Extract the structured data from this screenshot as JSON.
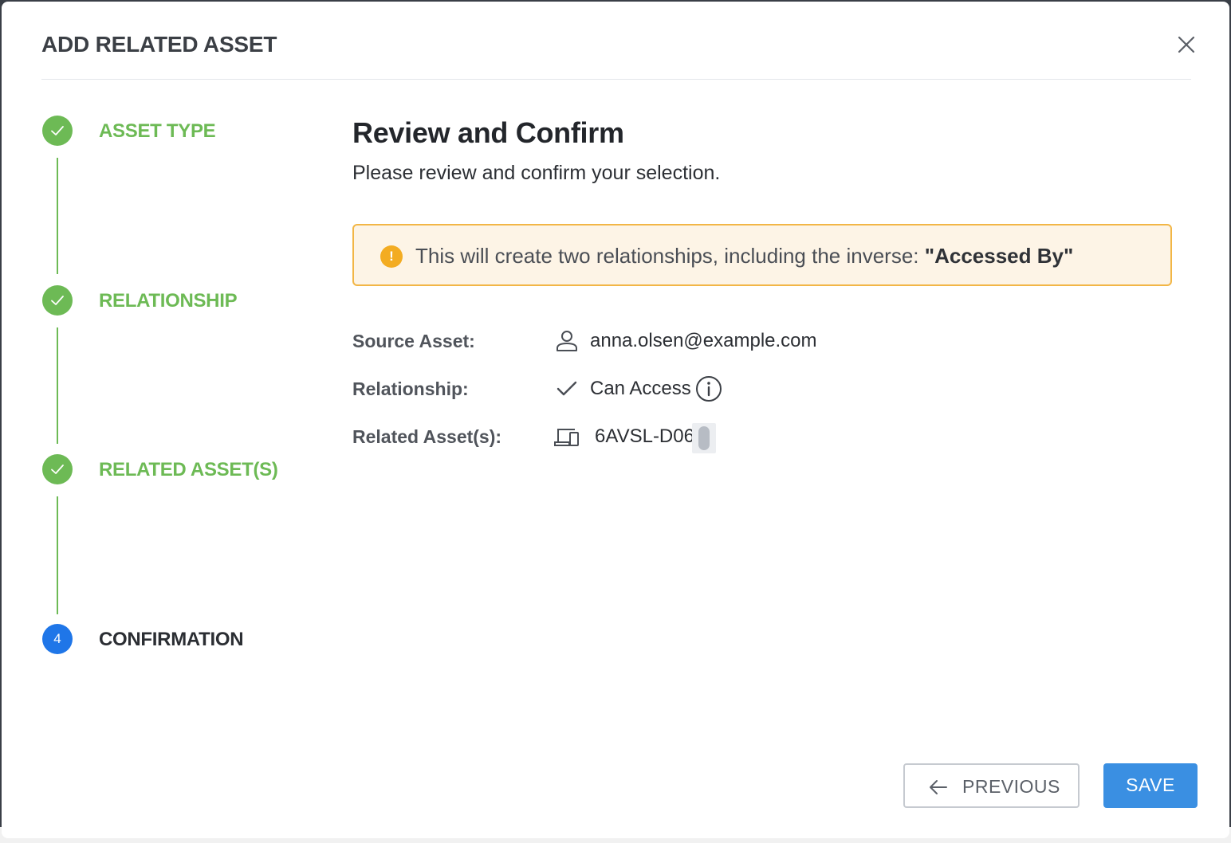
{
  "modal": {
    "title": "ADD RELATED ASSET"
  },
  "stepper": {
    "steps": [
      {
        "label": "ASSET TYPE",
        "status": "done"
      },
      {
        "label": "RELATIONSHIP",
        "status": "done"
      },
      {
        "label": "RELATED ASSET(S)",
        "status": "done"
      },
      {
        "label": "CONFIRMATION",
        "status": "active",
        "number": "4"
      }
    ]
  },
  "content": {
    "title": "Review and Confirm",
    "subtitle": "Please review and confirm your selection.",
    "alert": {
      "text": "This will create two relationships, including the inverse: ",
      "emphasis": "\"Accessed By\"",
      "icon": "warning-icon"
    },
    "details": {
      "source": {
        "label": "Source Asset:",
        "value": "anna.olsen@example.com",
        "icon": "user-icon"
      },
      "relationship": {
        "label": "Relationship:",
        "value": "Can Access",
        "icon": "check-icon"
      },
      "related": {
        "label": "Related Asset(s):",
        "value": "6AVSL-D06",
        "icon": "devices-icon"
      }
    }
  },
  "footer": {
    "previous_label": "PREVIOUS",
    "save_label": "SAVE"
  },
  "colors": {
    "success": "#6dba55",
    "active_step": "#1f76e8",
    "primary_button": "#3a8fe2",
    "alert_border": "#f2b646",
    "alert_bg": "#fdf4e6"
  }
}
